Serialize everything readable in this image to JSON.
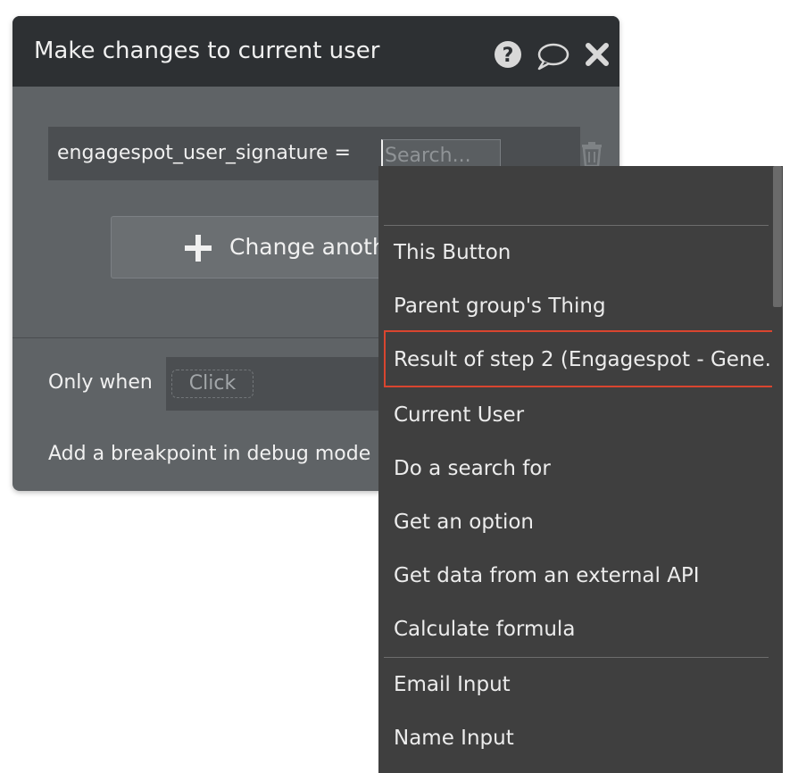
{
  "panel": {
    "title": "Make changes to current user",
    "field": {
      "label": "engagespot_user_signature  =",
      "placeholder": "Search..."
    },
    "change_button_label": "Change anoth",
    "only_when_label": "Only when",
    "condition_placeholder": "Click",
    "breakpoint_label": "Add a breakpoint in debug mode"
  },
  "dropdown": {
    "items": [
      "This Button",
      "Parent group's Thing",
      "Result of step 2 (Engagespot - Gene...)",
      "Current User",
      "Do a search for",
      "Get an option",
      "Get data from an external API",
      "Calculate formula",
      "Email Input",
      "Name Input"
    ],
    "highlighted_item": "Result of step 2 (Engagespot - Gene...)"
  },
  "colors": {
    "panel_bg": "#5f6366",
    "header_bg": "#2d3033",
    "dropdown_bg": "#3f3f3f",
    "highlight_border": "#d9452f"
  },
  "icons": [
    "help-icon",
    "comment-icon",
    "close-icon",
    "trash-icon",
    "plus-icon"
  ]
}
